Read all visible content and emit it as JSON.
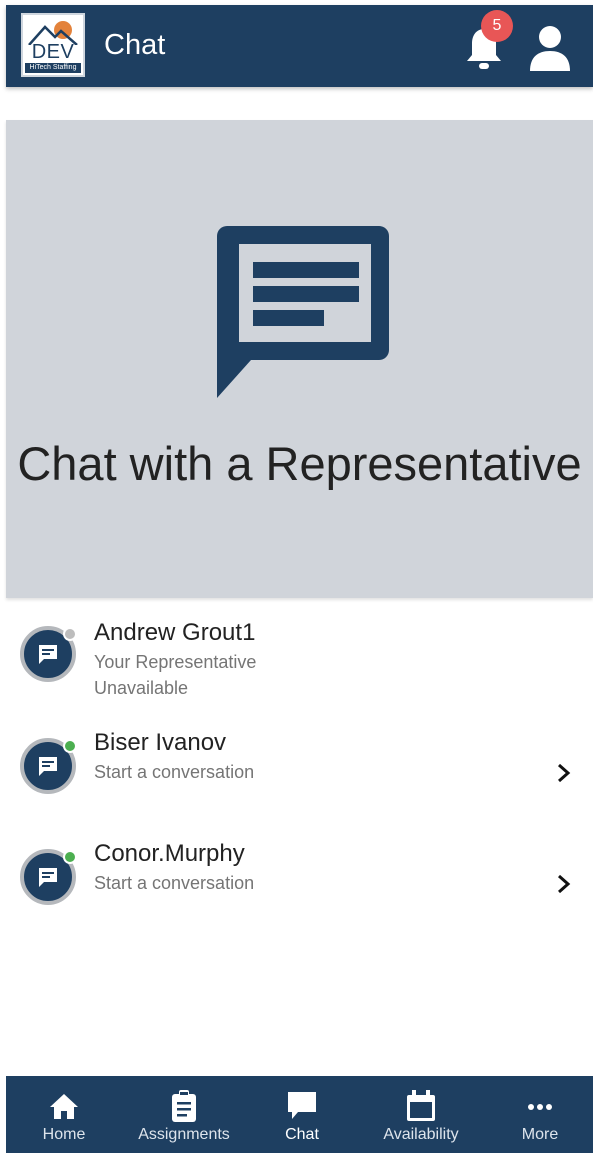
{
  "header": {
    "title": "Chat",
    "logo_text": "DEV",
    "logo_subtext": "HiTech Staffing",
    "notification_count": "5",
    "icons": [
      "bell-icon",
      "user-icon"
    ]
  },
  "hero": {
    "title": "Chat with a Representative",
    "icon": "chat-bubble-icon"
  },
  "representatives": [
    {
      "name": "Andrew Grout1",
      "subtitle": "Your Representative",
      "status_text": "Unavailable",
      "status_color": "#bdbdbd",
      "has_chevron": false
    },
    {
      "name": "Biser Ivanov",
      "subtitle": "Start a conversation",
      "status_color": "#4caf50",
      "has_chevron": true
    },
    {
      "name": "Conor.Murphy",
      "subtitle": "Start a conversation",
      "status_color": "#4caf50",
      "has_chevron": true
    }
  ],
  "bottom_nav": {
    "items": [
      {
        "label": "Home",
        "icon": "home-icon",
        "active": false
      },
      {
        "label": "Assignments",
        "icon": "clipboard-icon",
        "active": false
      },
      {
        "label": "Chat",
        "icon": "chat-icon",
        "active": true
      },
      {
        "label": "Availability",
        "icon": "calendar-icon",
        "active": false
      },
      {
        "label": "More",
        "icon": "more-icon",
        "active": false
      }
    ]
  },
  "colors": {
    "primary": "#1e3f61",
    "hero_background": "#d0d4da",
    "badge": "#e85656",
    "status_available": "#4caf50",
    "status_unavailable": "#bdbdbd"
  }
}
